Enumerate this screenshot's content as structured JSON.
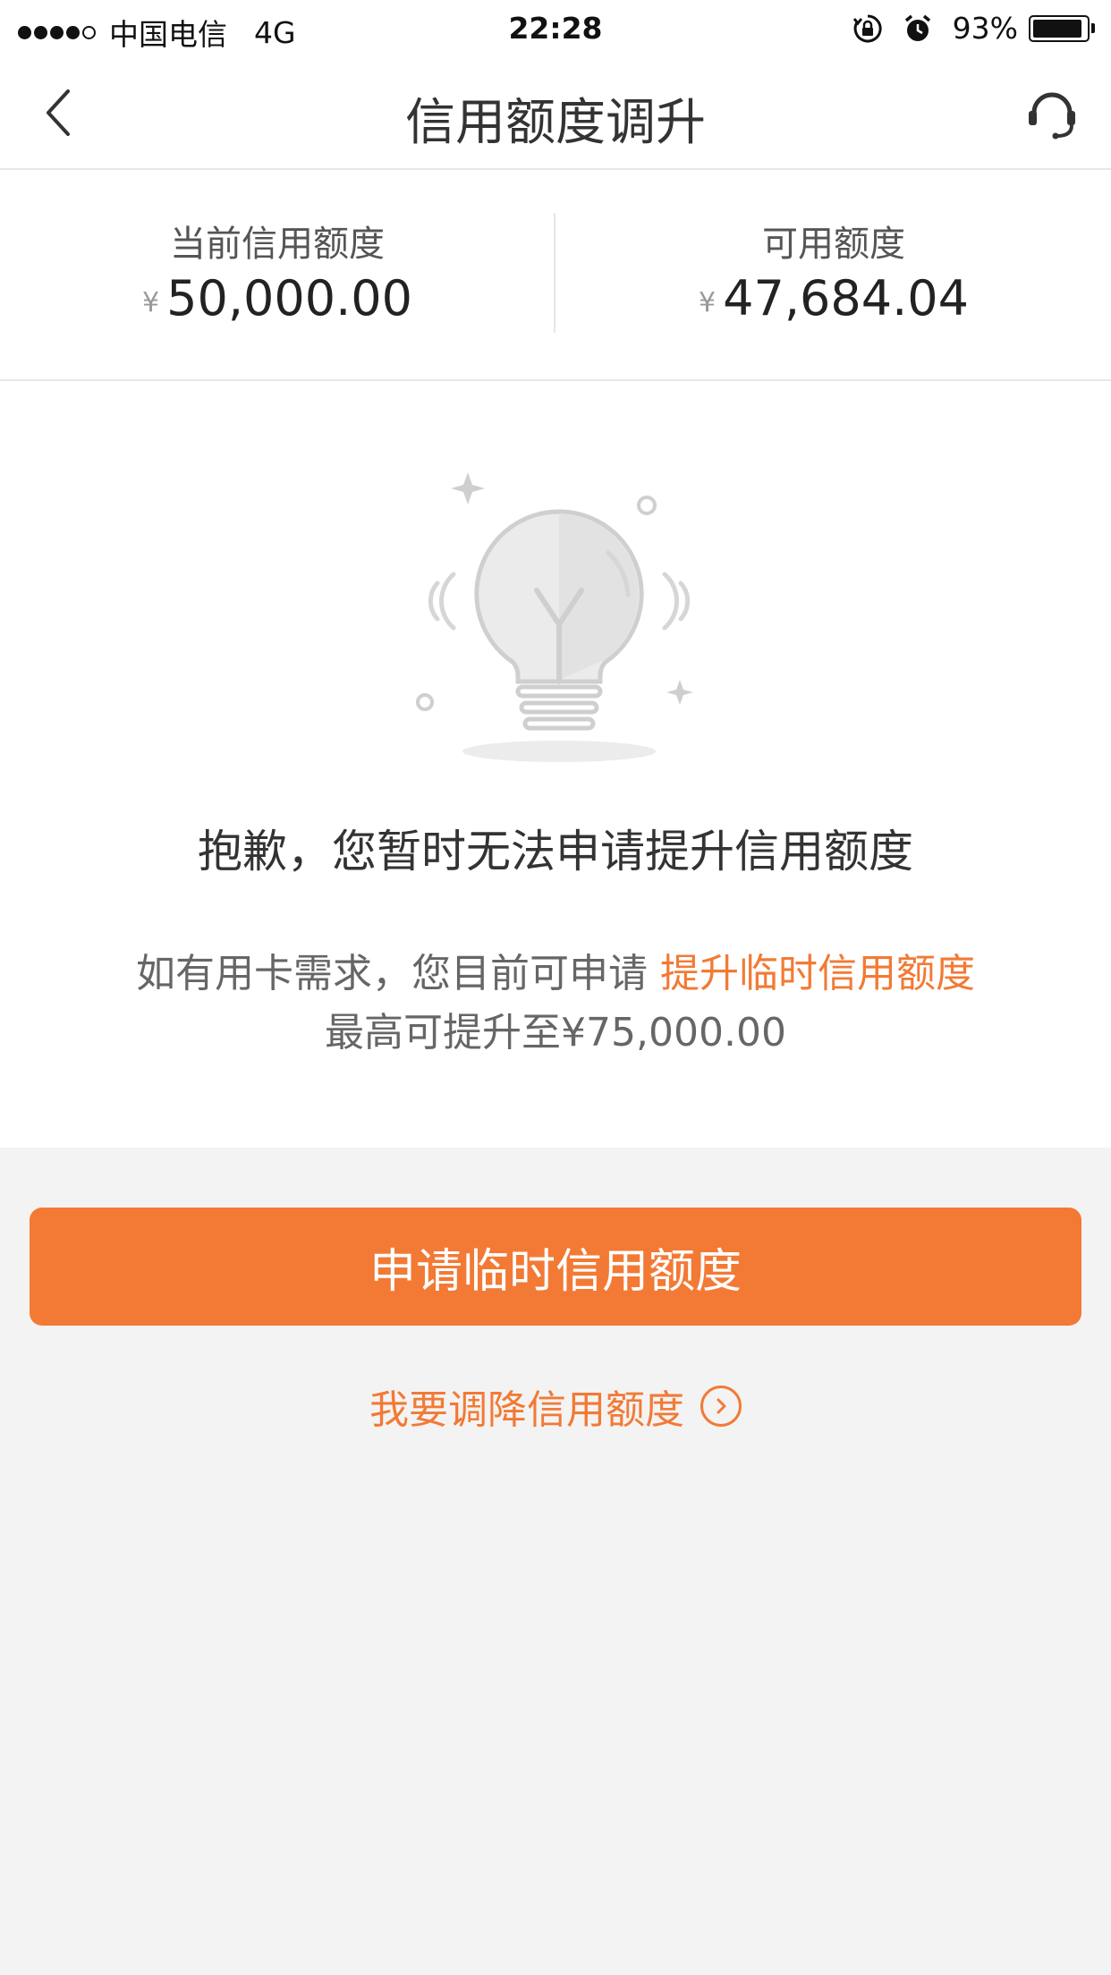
{
  "status_bar": {
    "carrier": "中国电信",
    "network": "4G",
    "time": "22:28",
    "battery": "93%",
    "battery_level": 0.93
  },
  "nav": {
    "title": "信用额度调升"
  },
  "summary": {
    "current_label": "当前信用额度",
    "current_currency": "¥",
    "current_amount": "50,000.00",
    "available_label": "可用额度",
    "available_currency": "¥",
    "available_amount": "47,684.04"
  },
  "message": {
    "sorry": "抱歉，您暂时无法申请提升信用额度",
    "hint_prefix": "如有用卡需求，您目前可申请 ",
    "hint_link": "提升临时信用额度",
    "hint_max": "最高可提升至¥75,000.00"
  },
  "actions": {
    "apply_button": "申请临时信用额度",
    "decrease_link": "我要调降信用额度"
  },
  "colors": {
    "accent": "#f27a35",
    "background": "#f3f3f3"
  }
}
